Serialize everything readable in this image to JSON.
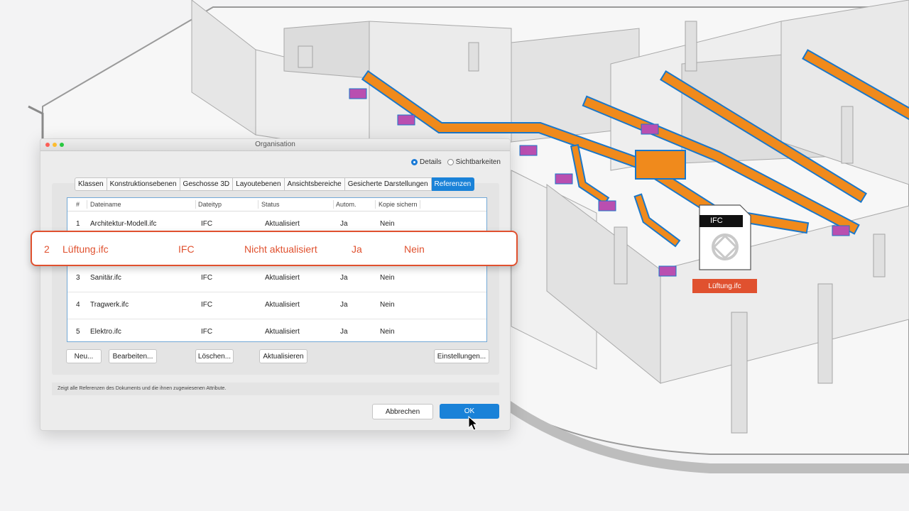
{
  "dialog": {
    "title": "Organisation",
    "view_options": [
      {
        "label": "Details",
        "selected": true
      },
      {
        "label": "Sichtbarkeiten",
        "selected": false
      }
    ],
    "tabs": [
      "Klassen",
      "Konstruktionsebenen",
      "Geschosse 3D",
      "Layoutebenen",
      "Ansichtsbereiche",
      "Gesicherte Darstellungen",
      "Referenzen"
    ],
    "active_tab": "Referenzen",
    "table": {
      "headers": [
        "#",
        "Dateiname",
        "Dateityp",
        "Status",
        "Autom.",
        "Kopie sichern"
      ],
      "rows": [
        [
          "1",
          "Architektur-Modell.ifc",
          "IFC",
          "Aktualisiert",
          "Ja",
          "Nein"
        ],
        [
          "2",
          "Lüftung.ifc",
          "IFC",
          "Nicht aktualisiert",
          "Ja",
          "Nein"
        ],
        [
          "3",
          "Sanitär.ifc",
          "IFC",
          "Aktualisiert",
          "Ja",
          "Nein"
        ],
        [
          "4",
          "Tragwerk.ifc",
          "IFC",
          "Aktualisiert",
          "Ja",
          "Nein"
        ],
        [
          "5",
          "Elektro.ifc",
          "IFC",
          "Aktualisiert",
          "Ja",
          "Nein"
        ]
      ]
    },
    "buttons": {
      "new": "Neu...",
      "edit": "Bearbeiten...",
      "delete": "Löschen...",
      "update": "Aktualisieren",
      "settings": "Einstellungen..."
    },
    "status_text": "Zeigt alle Referenzen des Dokuments und die ihnen zugewiesenen Attribute.",
    "cancel": "Abbrechen",
    "ok": "OK"
  },
  "callout": [
    "2",
    "Lüftung.ifc",
    "IFC",
    "Nicht aktualisiert",
    "Ja",
    "Nein"
  ],
  "ifc_file": {
    "type_label": "IFC",
    "name": "Lüftung.ifc"
  },
  "colors": {
    "accent": "#1a82d8",
    "highlight": "#e0512f",
    "duct": "#f08a1c",
    "duct_outline": "#1a77c9",
    "vent": "#b94fb0"
  }
}
